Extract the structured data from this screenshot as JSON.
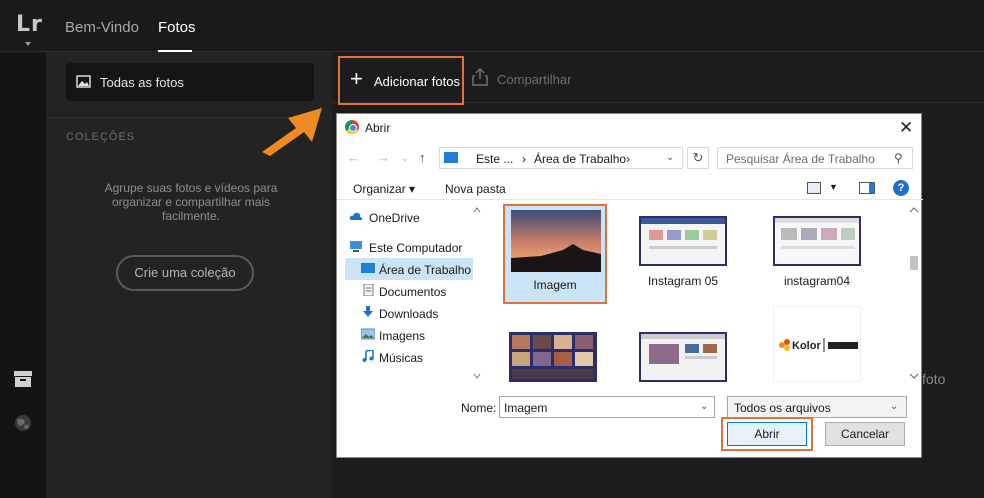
{
  "app": {
    "logo": "Lr",
    "nav": [
      "Bem-Vindo",
      "Fotos"
    ],
    "active_nav": "Fotos"
  },
  "rail": {
    "icons": [
      "archive-icon",
      "globe-icon"
    ]
  },
  "sidebar": {
    "all_photos": "Todas as fotos",
    "collections_title": "COLEÇÕES",
    "collections_desc": "Agrupe suas fotos e vídeos para organizar e compartilhar mais facilmente.",
    "create_collection": "Crie uma coleção"
  },
  "toolbar": {
    "add_photos": "Adicionar fotos",
    "share": "Compartilhar"
  },
  "background_text": "foto",
  "dialog": {
    "title": "Abrir",
    "address": {
      "crumbs": [
        "Este ...",
        "›",
        "Área de Trabalho",
        "›"
      ]
    },
    "search_placeholder": "Pesquisar Área de Trabalho",
    "commands": {
      "organize": "Organizar ▾",
      "new_folder": "Nova pasta"
    },
    "nav_items": [
      {
        "label": "OneDrive",
        "icon": "cloud-icon"
      },
      {
        "label": "Este Computador",
        "icon": "computer-icon"
      },
      {
        "label": "Área de Trabalho",
        "icon": "desktop-icon",
        "selected": true
      },
      {
        "label": "Documentos",
        "icon": "document-icon"
      },
      {
        "label": "Downloads",
        "icon": "download-icon"
      },
      {
        "label": "Imagens",
        "icon": "image-icon"
      },
      {
        "label": "Músicas",
        "icon": "music-icon"
      }
    ],
    "files": [
      {
        "name": "Imagem",
        "selected": true
      },
      {
        "name": "Instagram 05"
      },
      {
        "name": "instagram04"
      },
      {
        "name": ""
      },
      {
        "name": ""
      },
      {
        "name": "",
        "logo_text": "Kolor | GoPro"
      }
    ],
    "name_label": "Nome:",
    "name_value": "Imagem",
    "file_type": "Todos os arquivos",
    "open_button": "Abrir",
    "cancel_button": "Cancelar"
  },
  "colors": {
    "accent_orange": "#e2703a",
    "windows_blue": "#0078d7"
  }
}
